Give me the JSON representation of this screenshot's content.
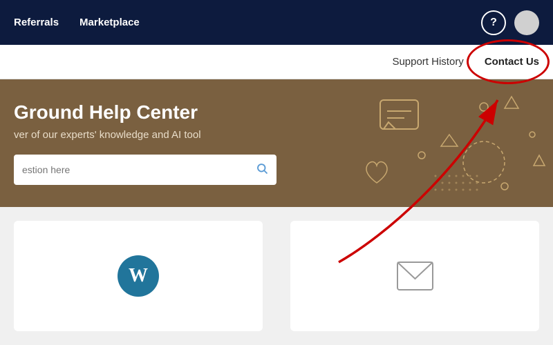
{
  "nav": {
    "links": [
      {
        "label": "Referrals",
        "id": "referrals"
      },
      {
        "label": "Marketplace",
        "id": "marketplace"
      }
    ],
    "help_icon": "?",
    "help_aria": "help"
  },
  "subnav": {
    "support_history": "Support History",
    "contact_us": "Contact Us"
  },
  "hero": {
    "title": "Ground Help Center",
    "subtitle": "ver of our experts' knowledge and AI tool",
    "search_placeholder": "estion here"
  },
  "cards": [
    {
      "id": "wordpress",
      "icon": "wp"
    },
    {
      "id": "email",
      "icon": "envelope"
    }
  ]
}
